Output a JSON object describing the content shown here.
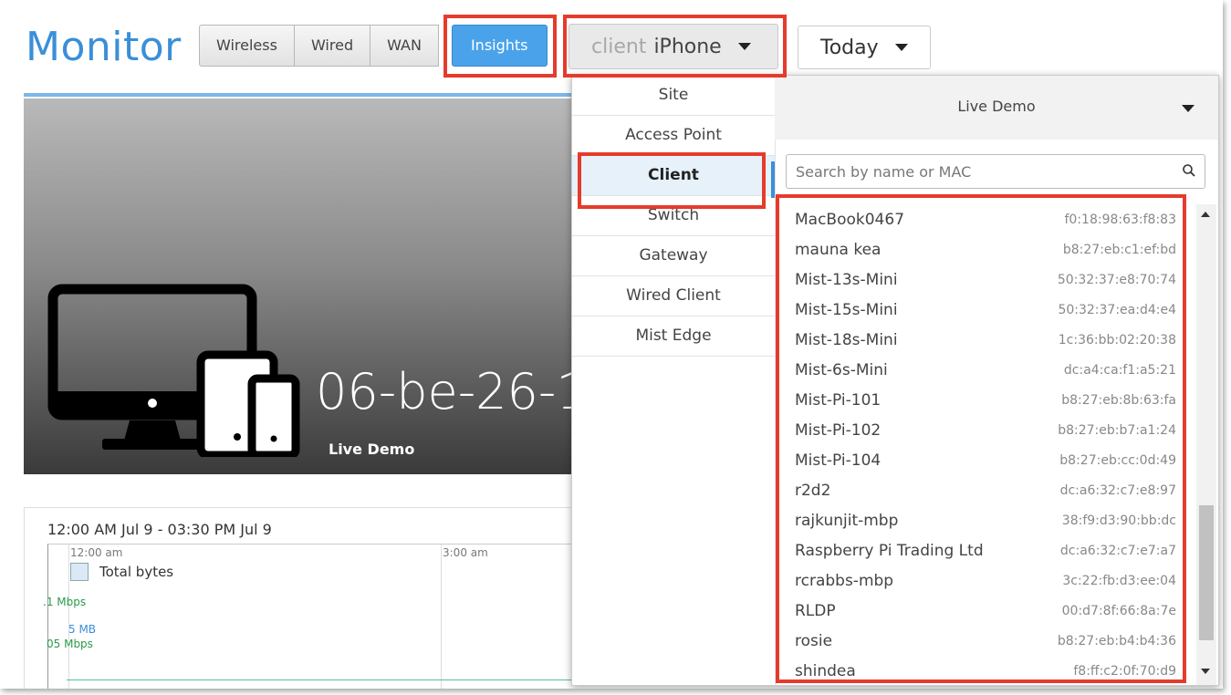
{
  "header": {
    "title": "Monitor",
    "tabs": [
      {
        "label": "Wireless"
      },
      {
        "label": "Wired"
      },
      {
        "label": "WAN"
      },
      {
        "label": "Insights"
      }
    ],
    "client_dropdown": {
      "key": "client",
      "value": "iPhone"
    },
    "time_dropdown": {
      "value": "Today"
    }
  },
  "hero": {
    "device_id": "06-be-26-1",
    "site": "Live Demo"
  },
  "chart": {
    "range": "12:00 AM Jul 9 - 03:30 PM Jul 9",
    "ticks": [
      "12:00 am",
      "3:00 am"
    ],
    "legend": "Total bytes",
    "y_labels": [
      ".1 Mbps",
      "5 MB",
      "05 Mbps"
    ]
  },
  "dropdown": {
    "categories": [
      "Site",
      "Access Point",
      "Client",
      "Switch",
      "Gateway",
      "Wired Client",
      "Mist Edge"
    ],
    "selected_category": "Client",
    "site": "Live Demo",
    "search_placeholder": "Search by name or MAC",
    "clients": [
      {
        "name": "MacBook0467",
        "mac": "f0:18:98:63:f8:83"
      },
      {
        "name": "mauna kea",
        "mac": "b8:27:eb:c1:ef:bd"
      },
      {
        "name": "Mist-13s-Mini",
        "mac": "50:32:37:e8:70:74"
      },
      {
        "name": "Mist-15s-Mini",
        "mac": "50:32:37:ea:d4:e4"
      },
      {
        "name": "Mist-18s-Mini",
        "mac": "1c:36:bb:02:20:38"
      },
      {
        "name": "Mist-6s-Mini",
        "mac": "dc:a4:ca:f1:a5:21"
      },
      {
        "name": "Mist-Pi-101",
        "mac": "b8:27:eb:8b:63:fa"
      },
      {
        "name": "Mist-Pi-102",
        "mac": "b8:27:eb:b7:a1:24"
      },
      {
        "name": "Mist-Pi-104",
        "mac": "b8:27:eb:cc:0d:49"
      },
      {
        "name": "r2d2",
        "mac": "dc:a6:32:c7:e8:97"
      },
      {
        "name": "rajkunjit-mbp",
        "mac": "38:f9:d3:90:bb:dc"
      },
      {
        "name": "Raspberry Pi Trading Ltd",
        "mac": "dc:a6:32:c7:e7:a7"
      },
      {
        "name": "rcrabbs-mbp",
        "mac": "3c:22:fb:d3:ee:04"
      },
      {
        "name": "RLDP",
        "mac": "00:d7:8f:66:8a:7e"
      },
      {
        "name": "rosie",
        "mac": "b8:27:eb:b4:b4:36"
      },
      {
        "name": "shindea",
        "mac": "f8:ff:c2:0f:70:d9"
      }
    ]
  },
  "colors": {
    "accent": "#3a8fd8",
    "active_tab": "#4aa3ea",
    "highlight": "#e53b2c",
    "chart_line": "#4fbfa7"
  }
}
